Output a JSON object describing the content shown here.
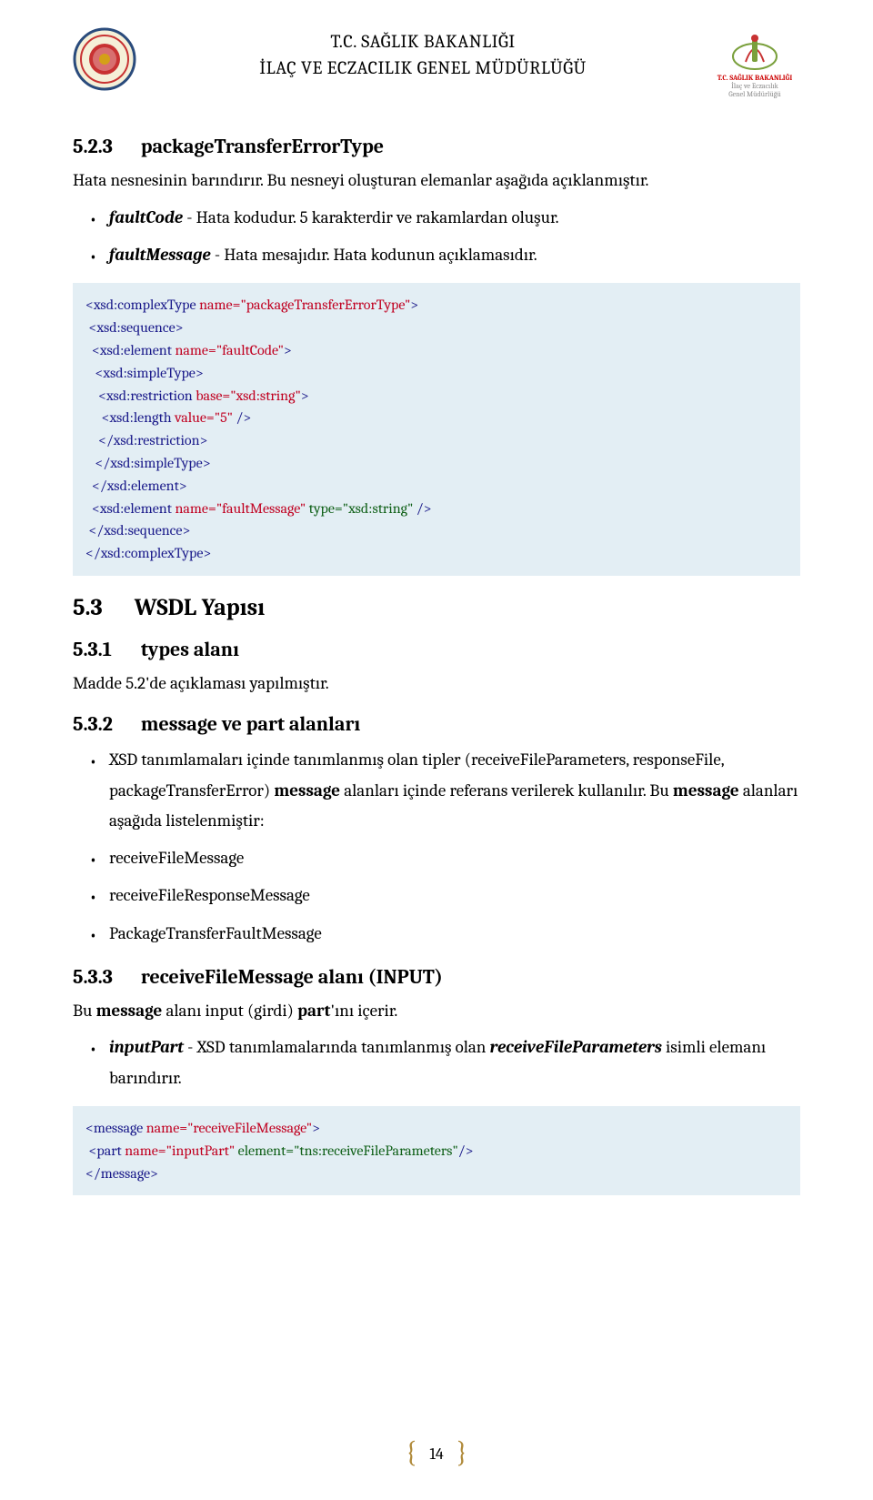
{
  "header": {
    "line1": "T.C. SAĞLIK BAKANLIĞI",
    "line2": "İLAÇ VE ECZACILIK GENEL MÜDÜRLÜĞÜ",
    "right_logo_caption_top": "T.C. SAĞLIK BAKANLIĞI",
    "right_logo_caption_l1": "İlaç ve Eczacılık",
    "right_logo_caption_l2": "Genel Müdürlüğü"
  },
  "s523": {
    "num": "5.2.3",
    "title": "packageTransferErrorType",
    "p": "Hata nesnesinin barındırır. Bu nesneyi oluşturan elemanlar aşağıda açıklanmıştır.",
    "b1_label": "faultCode",
    "b1_text": " - Hata kodudur. 5 karakterdir ve rakamlardan oluşur.",
    "b2_label": "faultMessage",
    "b2_text": " - Hata mesajıdır. Hata kodunun açıklamasıdır."
  },
  "code1": {
    "l1a": "<xsd:complexType",
    "l1b": " name=\"packageTransferErrorType\"",
    "l1c": ">",
    "l2": " <xsd:sequence>",
    "l3a": "  <xsd:element",
    "l3b": " name=\"faultCode\"",
    "l3c": ">",
    "l4": "   <xsd:simpleType>",
    "l5a": "    <xsd:restriction",
    "l5b": " base=\"xsd:string\"",
    "l5c": ">",
    "l6a": "     <xsd:length",
    "l6b": " value=\"5\"",
    "l6c": " />",
    "l7": "    </xsd:restriction>",
    "l8": "   </xsd:simpleType>",
    "l9": "  </xsd:element>",
    "l10a": "  <xsd:element",
    "l10b": " name=\"faultMessage\"",
    "l10c": " type=\"xsd:string\"",
    "l10d": " />",
    "l11": " </xsd:sequence>",
    "l12": "</xsd:complexType>"
  },
  "s53": {
    "num": "5.3",
    "title": "WSDL Yapısı"
  },
  "s531": {
    "num": "5.3.1",
    "title": "types alanı",
    "p": "Madde 5.2'de açıklaması yapılmıştır."
  },
  "s532": {
    "num": "5.3.2",
    "title": "message ve part alanları",
    "b1_pre": "XSD tanımlamaları içinde tanımlanmış olan tipler (receiveFileParameters, responseFile, packageTransferError) ",
    "b1_bold1": "message",
    "b1_mid": " alanları içinde referans verilerek kullanılır. Bu ",
    "b1_bold2": "message",
    "b1_post": " alanları aşağıda listelenmiştir:",
    "b2": "receiveFileMessage",
    "b3": "receiveFileResponseMessage",
    "b4": "PackageTransferFaultMessage"
  },
  "s533": {
    "num": "5.3.3",
    "title": "receiveFileMessage alanı (INPUT)",
    "p_pre": "Bu ",
    "p_b1": "message",
    "p_mid1": " alanı input (girdi) ",
    "p_b2": "part",
    "p_post": "'ını içerir.",
    "b1_label": "inputPart",
    "b1_mid": " - XSD tanımlamalarında tanımlanmış olan ",
    "b1_em": "receiveFileParameters",
    "b1_post": " isimli elemanı barındırır."
  },
  "code2": {
    "l1a": "<message",
    "l1b": " name=\"receiveFileMessage\"",
    "l1c": ">",
    "l2a": " <part",
    "l2b": " name=\"inputPart\"",
    "l2c": " element=\"tns:receiveFileParameters\"",
    "l2d": "/>",
    "l3": "</message>"
  },
  "footer": {
    "page": "14"
  }
}
